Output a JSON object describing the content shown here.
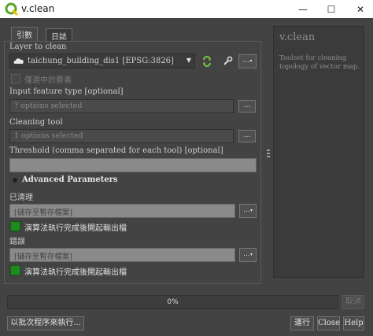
{
  "window": {
    "title": "v.clean",
    "minimize_glyph": "—",
    "maximize_glyph": "☐",
    "close_glyph": "✕"
  },
  "tabs": [
    {
      "label": "引數"
    },
    {
      "label": "日誌"
    }
  ],
  "params": {
    "layer_label": "Layer to clean",
    "layer_value": "taichung_building_dis1 [EPSG:3826]",
    "selected_only_label": "僅選中的要素",
    "feature_type_label": "Input feature type [optional]",
    "feature_type_value": "? options selected",
    "cleaning_tool_label": "Cleaning tool",
    "cleaning_tool_value": "1 options selected",
    "threshold_label": "Threshold (comma separated for each tool) [optional]",
    "threshold_value": "",
    "advanced_label": "Advanced Parameters",
    "cleaned_label": "已清理",
    "cleaned_value": "[儲存至暫存檔案]",
    "cleaned_open_label": "演算法執行完成後開起輸出檔",
    "errors_label": "錯誤",
    "errors_value": "[儲存至暫存檔案]",
    "errors_open_label": "演算法執行完成後開起輸出檔",
    "dots_label": "…"
  },
  "help": {
    "title": "v.clean",
    "text": "Toolset for cleaning topology of vector map."
  },
  "progress": {
    "value": "0%",
    "cancel_label": "取消"
  },
  "footer": {
    "batch_label": "以批次程序來執行...",
    "run_label": "運行",
    "close_label": "Close",
    "help_label": "Help"
  },
  "colors": {
    "accent_green": "#1f8a1f",
    "qgis_green": "#5aa52a",
    "qgis_yellow": "#f0c300"
  }
}
